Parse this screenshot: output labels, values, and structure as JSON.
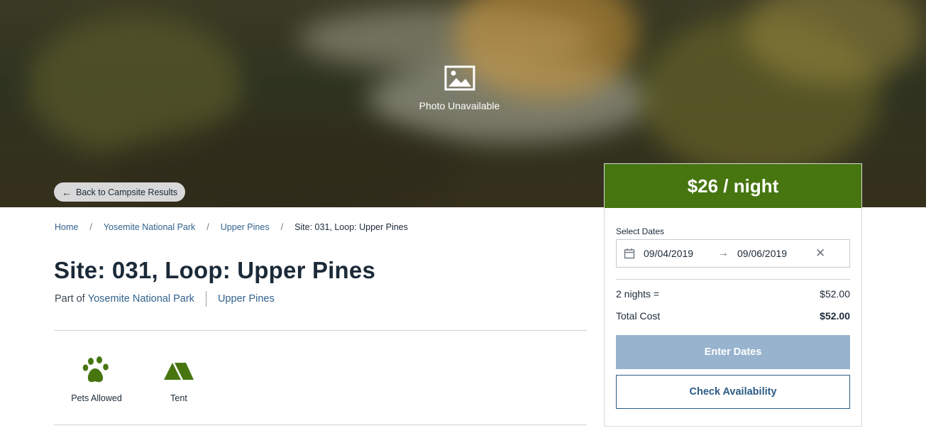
{
  "hero": {
    "photo_label": "Photo Unavailable",
    "back_label": "Back to Campsite Results"
  },
  "breadcrumb": {
    "items": [
      "Home",
      "Yosemite National Park",
      "Upper Pines"
    ],
    "current": "Site: 031, Loop: Upper Pines",
    "separator": "/"
  },
  "site": {
    "title": "Site: 031, Loop: Upper Pines",
    "part_of_prefix": "Part of",
    "park_link": "Yosemite National Park",
    "loop_link": "Upper Pines"
  },
  "amenities": [
    {
      "label": "Pets Allowed",
      "icon": "paw-icon"
    },
    {
      "label": "Tent",
      "icon": "tent-icon"
    }
  ],
  "booking": {
    "price": "$26 / night",
    "select_dates_label": "Select Dates",
    "start_date": "09/04/2019",
    "end_date": "09/06/2019",
    "arrow": "→",
    "clear": "✕",
    "nights_label": "2 nights =",
    "nights_value": "$52.00",
    "total_label": "Total Cost",
    "total_value": "$52.00",
    "enter_dates_label": "Enter Dates",
    "check_availability_label": "Check Availability"
  },
  "colors": {
    "accent_green": "#477611",
    "link_blue": "#32628c",
    "disabled_button": "#98b3cd"
  }
}
